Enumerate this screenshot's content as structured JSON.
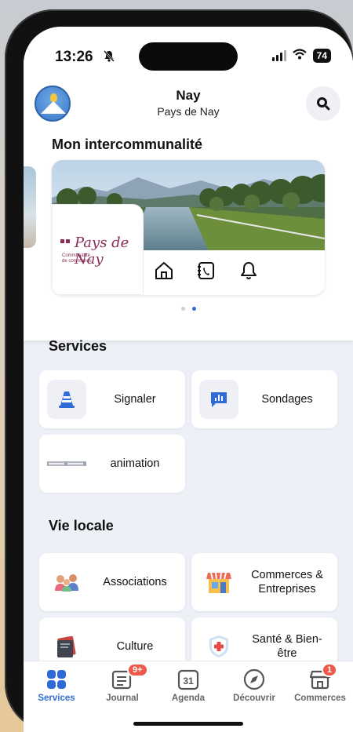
{
  "status_bar": {
    "time": "13:26",
    "battery": "74"
  },
  "header": {
    "title": "Nay",
    "subtitle": "Pays de Nay"
  },
  "intercommunalite": {
    "heading": "Mon intercommunalité",
    "logo_text": "Pays de Nay",
    "logo_small": "Communauté de communes",
    "actions": [
      "home-icon",
      "phone-book-icon",
      "bell-icon"
    ],
    "carousel_pages": 2,
    "carousel_active": 2
  },
  "services": {
    "heading": "Services",
    "items": [
      {
        "label": "Signaler",
        "icon": "cone-icon"
      },
      {
        "label": "Sondages",
        "icon": "poll-chart-icon"
      },
      {
        "label": "animation",
        "icon": "animation-banner-icon"
      }
    ]
  },
  "vie_locale": {
    "heading": "Vie locale",
    "items": [
      {
        "label": "Associations",
        "icon": "people-icon"
      },
      {
        "label": "Commerces & Entreprises",
        "icon": "shop-icon"
      },
      {
        "label": "Culture",
        "icon": "books-icon"
      },
      {
        "label": "Santé & Bien-être",
        "icon": "health-shield-icon"
      }
    ]
  },
  "tabbar": {
    "tabs": [
      {
        "label": "Services",
        "icon": "grid-icon",
        "active": true
      },
      {
        "label": "Journal",
        "icon": "newspaper-icon",
        "badge": "9+"
      },
      {
        "label": "Agenda",
        "icon": "calendar-icon",
        "day": "31"
      },
      {
        "label": "Découvrir",
        "icon": "compass-icon"
      },
      {
        "label": "Commerces",
        "icon": "store-icon",
        "badge": "1"
      }
    ]
  },
  "colors": {
    "accent": "#2f6bd6",
    "badge": "#ee5a4a",
    "background": "#eef0f8"
  }
}
